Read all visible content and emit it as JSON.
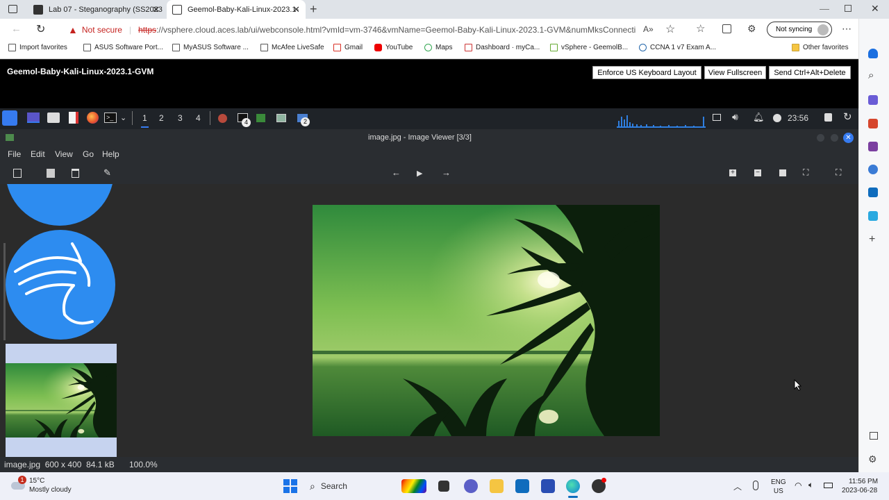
{
  "browser": {
    "tabs": [
      {
        "label": "Lab 07 - Steganography (SS2023"
      },
      {
        "label": "Geemol-Baby-Kali-Linux-2023.1-"
      }
    ],
    "security": "Not secure",
    "url_scheme": "https",
    "url_rest": "://vsphere.cloud.aces.lab/ui/webconsole.html?vmId=vm-3746&vmName=Geemol-Baby-Kali-Linux-2023.1-GVM&numMksConnectio...",
    "profile": "Not syncing",
    "bookmarks": [
      "Import favorites",
      "ASUS Software Port...",
      "MyASUS Software ...",
      "McAfee LiveSafe",
      "Gmail",
      "YouTube",
      "Maps",
      "Dashboard · myCa...",
      "vSphere - GeemolB...",
      "CCNA 1 v7 Exam A..."
    ],
    "other_favorites": "Other favorites"
  },
  "vsphere": {
    "title": "Geemol-Baby-Kali-Linux-2023.1-GVM",
    "buttons": [
      "Enforce US Keyboard Layout",
      "View Fullscreen",
      "Send Ctrl+Alt+Delete"
    ]
  },
  "kali": {
    "workspaces": [
      "1",
      "2",
      "3",
      "4"
    ],
    "badge_a": "4",
    "badge_b": "2",
    "clock": "23:56"
  },
  "viewer": {
    "title": "image.jpg - Image Viewer [3/3]",
    "menu": [
      "File",
      "Edit",
      "View",
      "Go",
      "Help"
    ],
    "status_file": "image.jpg  600 x 400  84.1 kB",
    "status_zoom": "100.0%"
  },
  "taskbar": {
    "weather_temp": "15°C",
    "weather_desc": "Mostly cloudy",
    "weather_badge": "1",
    "search": "Search",
    "lang1": "ENG",
    "lang2": "US",
    "time": "11:56 PM",
    "date": "2023-06-28"
  }
}
